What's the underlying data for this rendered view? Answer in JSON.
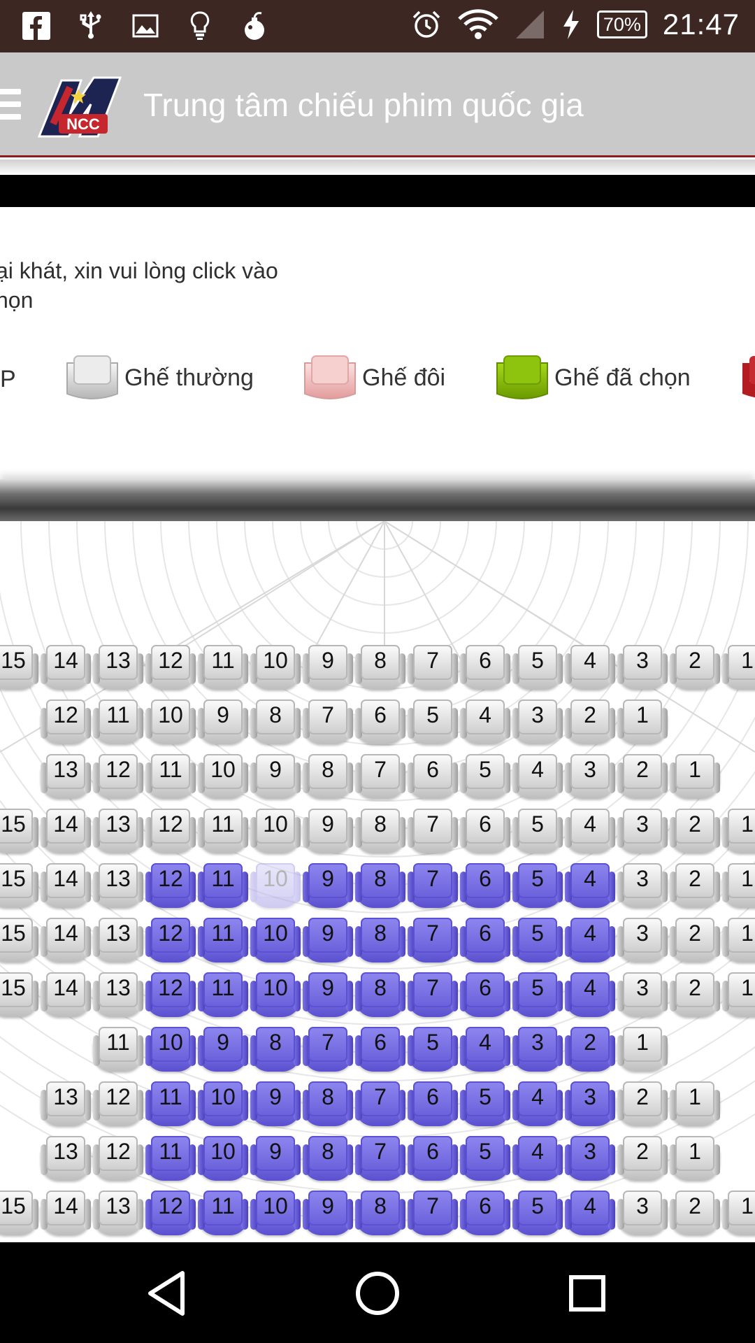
{
  "status_bar": {
    "time": "21:47",
    "battery": "70%",
    "left_icons": [
      "facebook-icon",
      "usb-icon",
      "image-icon",
      "lightbulb-icon",
      "notification-bomb-icon"
    ],
    "right_icons": [
      "alarm-icon",
      "wifi-icon",
      "signal-icon",
      "charging-icon"
    ]
  },
  "header": {
    "title": "Trung tâm chiếu phim quốc gia",
    "logo_text": "NCC"
  },
  "info": {
    "line1": "ại khát, xin vui lòng click vào",
    "line2": "họn"
  },
  "legend": {
    "vip_tail": "P",
    "normal": "Ghế thường",
    "double": "Ghế đôi",
    "selected": "Ghế đã chọn"
  },
  "seat_rows": [
    {
      "start": 15,
      "end": 1,
      "first_col": 0,
      "taken": []
    },
    {
      "start": 12,
      "end": 1,
      "first_col": 1,
      "taken": []
    },
    {
      "start": 13,
      "end": 1,
      "first_col": 1,
      "taken": []
    },
    {
      "start": 15,
      "end": 1,
      "first_col": 0,
      "taken": []
    },
    {
      "start": 15,
      "end": 1,
      "first_col": 0,
      "taken": [
        12,
        11,
        9,
        8,
        7,
        6,
        5,
        4
      ],
      "faded": [
        10
      ]
    },
    {
      "start": 15,
      "end": 1,
      "first_col": 0,
      "taken": [
        12,
        11,
        10,
        9,
        8,
        7,
        6,
        5,
        4
      ]
    },
    {
      "start": 15,
      "end": 1,
      "first_col": 0,
      "taken": [
        12,
        11,
        10,
        9,
        8,
        7,
        6,
        5,
        4
      ]
    },
    {
      "start": 11,
      "end": 1,
      "first_col": 2,
      "taken": [
        10,
        9,
        8,
        7,
        6,
        5,
        4,
        3,
        2
      ]
    },
    {
      "start": 13,
      "end": 1,
      "first_col": 1,
      "taken": [
        11,
        10,
        9,
        8,
        7,
        6,
        5,
        4,
        3
      ]
    },
    {
      "start": 13,
      "end": 1,
      "first_col": 1,
      "taken": [
        11,
        10,
        9,
        8,
        7,
        6,
        5,
        4,
        3
      ]
    },
    {
      "start": 15,
      "end": 1,
      "first_col": 0,
      "taken": [
        12,
        11,
        10,
        9,
        8,
        7,
        6,
        5,
        4
      ]
    }
  ],
  "nav": [
    "back-icon",
    "home-icon",
    "recents-icon"
  ]
}
